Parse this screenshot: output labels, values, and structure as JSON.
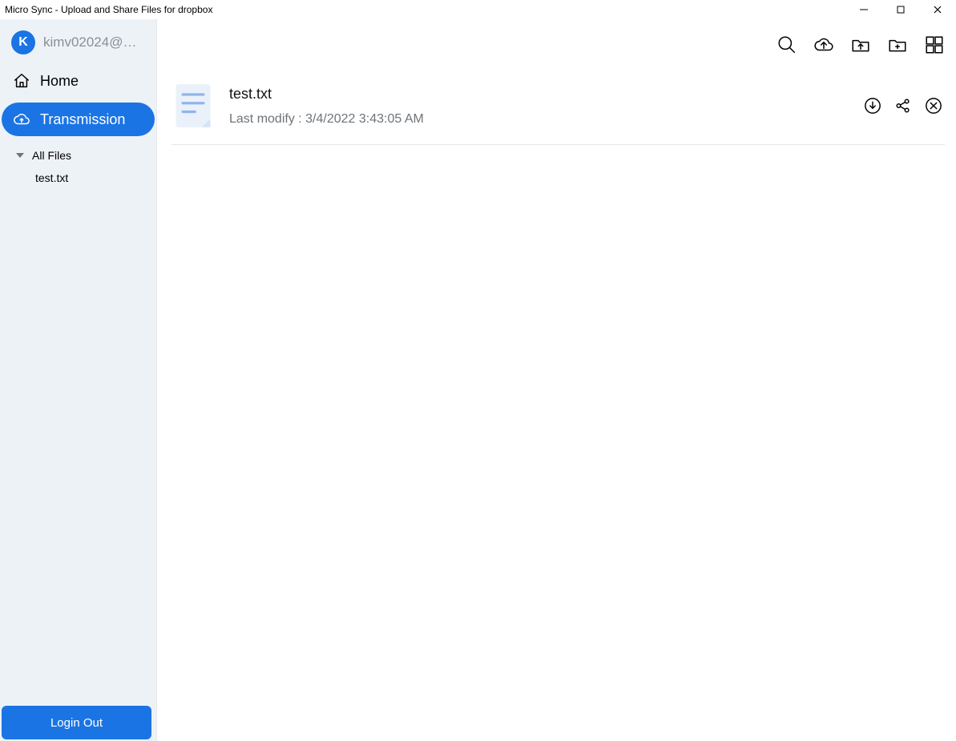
{
  "window": {
    "title": "Micro Sync - Upload and Share Files for dropbox"
  },
  "sidebar": {
    "account": {
      "avatar_letter": "K",
      "name": "kimv02024@…"
    },
    "nav": {
      "home_label": "Home",
      "transmission_label": "Transmission"
    },
    "tree": {
      "root_label": "All Files",
      "items": [
        {
          "label": "test.txt"
        }
      ]
    },
    "logout_label": "Login Out"
  },
  "main": {
    "file": {
      "name": "test.txt",
      "modified_prefix": "Last modify  : ",
      "modified_value": "3/4/2022 3:43:05 AM"
    }
  }
}
